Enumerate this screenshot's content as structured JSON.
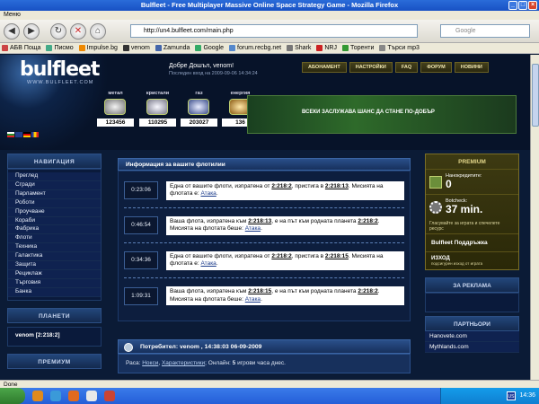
{
  "window": {
    "title": "Bulfleet - Free Multiplayer Massive Online Space Strategy Game - Mozilla Firefox",
    "menu_label": "Меню",
    "url": "http://un4.bulfleet.com/main.php",
    "search_placeholder": "Google"
  },
  "bookmarks": [
    "АБВ Поща",
    "Писмо",
    "Impulse.bg",
    "venom",
    "Zamunda",
    "Google",
    "forum.recbg.net",
    "Shark",
    "NRJ",
    "Торенти",
    "Търси mp3"
  ],
  "header": {
    "logo": "bulfleet",
    "logo_sub": "WWW.BULFLEET.COM",
    "greeting": "Добре Дошъл, venom!",
    "last_login": "Последен вход на 2009-09-06 14:34:24",
    "nav": [
      "АБОНАМЕНТ",
      "НАСТРОЙКИ",
      "FAQ",
      "ФОРУМ",
      "НОВИНИ"
    ],
    "banner_text": "ВСЕКИ ЗАСЛУЖАВА ШАНС ДА СТАНЕ ПО-ДОБЪР"
  },
  "resources": [
    {
      "label": "метал",
      "value": "123456"
    },
    {
      "label": "кристали",
      "value": "110295"
    },
    {
      "label": "газ",
      "value": "203027"
    },
    {
      "label": "енергия",
      "value": "136"
    }
  ],
  "left": {
    "nav_title": "НАВИГАЦИЯ",
    "nav_items": [
      "Преглед",
      "Сгради",
      "Парламент",
      "Роботи",
      "Проучване",
      "Кораби",
      "Фабрика",
      "Флоти",
      "Техника",
      "Галактика",
      "Защита",
      "Рециклаж",
      "Търговия",
      "Банка"
    ],
    "planets_title": "ПЛАНЕТИ",
    "planet": "venom [2:218:2]",
    "premium_title": "ПРЕМИУМ"
  },
  "main": {
    "fleets_title": "Информация за вашите флотилии",
    "fleets": [
      {
        "time": "0:23:06",
        "pre": "Една от вашите флоти, изпратена от ",
        "from": "2:218:2",
        "mid": ", пристига в ",
        "to": "2:218:13",
        "post": ". Мисията на флотата е: ",
        "mission": "Атака",
        "end": "."
      },
      {
        "time": "0:46:54",
        "pre": "Ваша флота, изпратена към ",
        "from": "2:218:13",
        "mid": ", е на път към родната планета ",
        "to": "2:218:2",
        "post": ". Мисията на флотата беше: ",
        "mission": "Атака",
        "end": "."
      },
      {
        "time": "0:34:36",
        "pre": "Една от вашите флоти, изпратена от ",
        "from": "2:218:2",
        "mid": ", пристига в ",
        "to": "2:218:15",
        "post": ". Мисията на флотата е: ",
        "mission": "Атака",
        "end": "."
      },
      {
        "time": "1:09:31",
        "pre": "Ваша флота, изпратена към ",
        "from": "2:218:15",
        "mid": ", е на път към родната планета ",
        "to": "2:218:2",
        "post": ". Мисията на флотата беше: ",
        "mission": "Атака",
        "end": "."
      }
    ],
    "user_title": "Потребител: venom , 14:38:03 06-09-2009",
    "race_label": "Раса: ",
    "race": "Нокси",
    "traits": "Характеристики",
    "online": "Онлайн: ",
    "online_hours": "5",
    "online_post": " игрови часа днес."
  },
  "right": {
    "premium_title": "PREMIUM",
    "nano_label": "Нанокредитите:",
    "nano_value": "0",
    "botcheck_label": "Botcheck:",
    "botcheck_value": "37 min.",
    "botcheck_note": "Гласувайте за играта и спечелете ресурс",
    "support": "Bulfleet Поддръжка",
    "exit": "ИЗХОД",
    "exit_note": "подсигурен изход от играта",
    "ads_title": "ЗА РЕКЛАМА",
    "partners_title": "ПАРТНЬОРИ",
    "partners": [
      "Hanovete.com",
      "Mythlands.com"
    ]
  },
  "status": {
    "text": "Done",
    "clock": "14:36",
    "lang": "US"
  }
}
